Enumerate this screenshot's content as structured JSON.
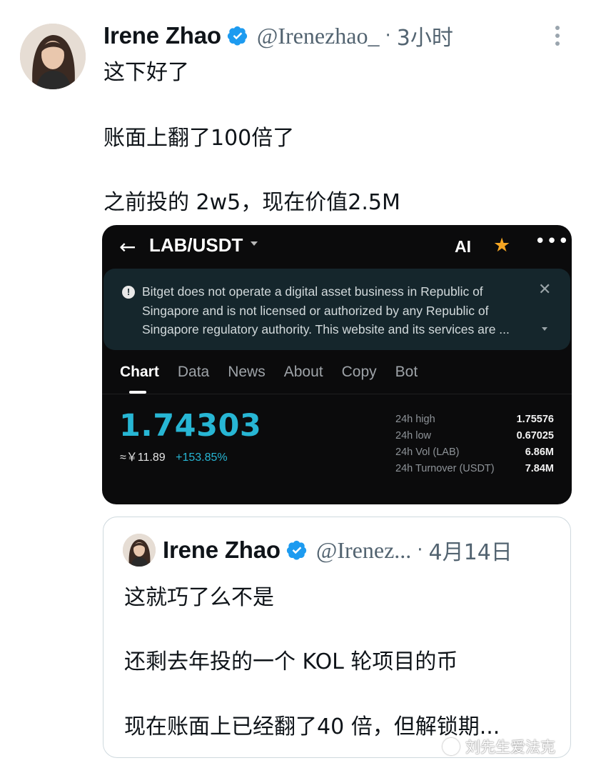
{
  "tweet": {
    "name": "Irene Zhao",
    "handle": "@Irenezhao_",
    "time": "3小时",
    "lines": [
      "这下好了",
      "账面上翻了100倍了",
      "之前投的 2w5，现在价值2.5M"
    ]
  },
  "screenshot": {
    "pair": "LAB/USDT",
    "ai_label": "AI",
    "notice": "Bitget does not operate a digital asset business in Republic of Singapore and is not licensed or authorized by any Republic of Singapore regulatory authority. This website and its services are ...",
    "tabs": [
      "Chart",
      "Data",
      "News",
      "About",
      "Copy",
      "Bot"
    ],
    "active_tab": "Chart",
    "price": "1.74303",
    "price_cny": "≈￥11.89",
    "change": "+153.85%",
    "stats": [
      {
        "label": "24h high",
        "value": "1.75576"
      },
      {
        "label": "24h low",
        "value": "0.67025"
      },
      {
        "label": "24h Vol (LAB)",
        "value": "6.86M"
      },
      {
        "label": "24h Turnover (USDT)",
        "value": "7.84M"
      }
    ],
    "colors": {
      "price": "#27b6d4",
      "star": "#f5a623",
      "notice_bg": "#15262c"
    }
  },
  "quoted": {
    "name": "Irene Zhao",
    "handle": "@Irenez...",
    "time": "4月14日",
    "lines": [
      "这就巧了么不是",
      "还剩去年投的一个 KOL 轮项目的币",
      "现在账面上已经翻了40 倍，但解锁期..."
    ]
  },
  "watermark": "刘先生爱法克",
  "icons": [
    "avatar",
    "verified-badge-icon",
    "more-options-icon",
    "back-arrow-icon",
    "dropdown-caret-icon",
    "star-icon",
    "ellipsis-icon",
    "warning-icon",
    "close-icon"
  ],
  "colors": {
    "verified": "#1d9bf0",
    "secondary_text": "#536471"
  }
}
